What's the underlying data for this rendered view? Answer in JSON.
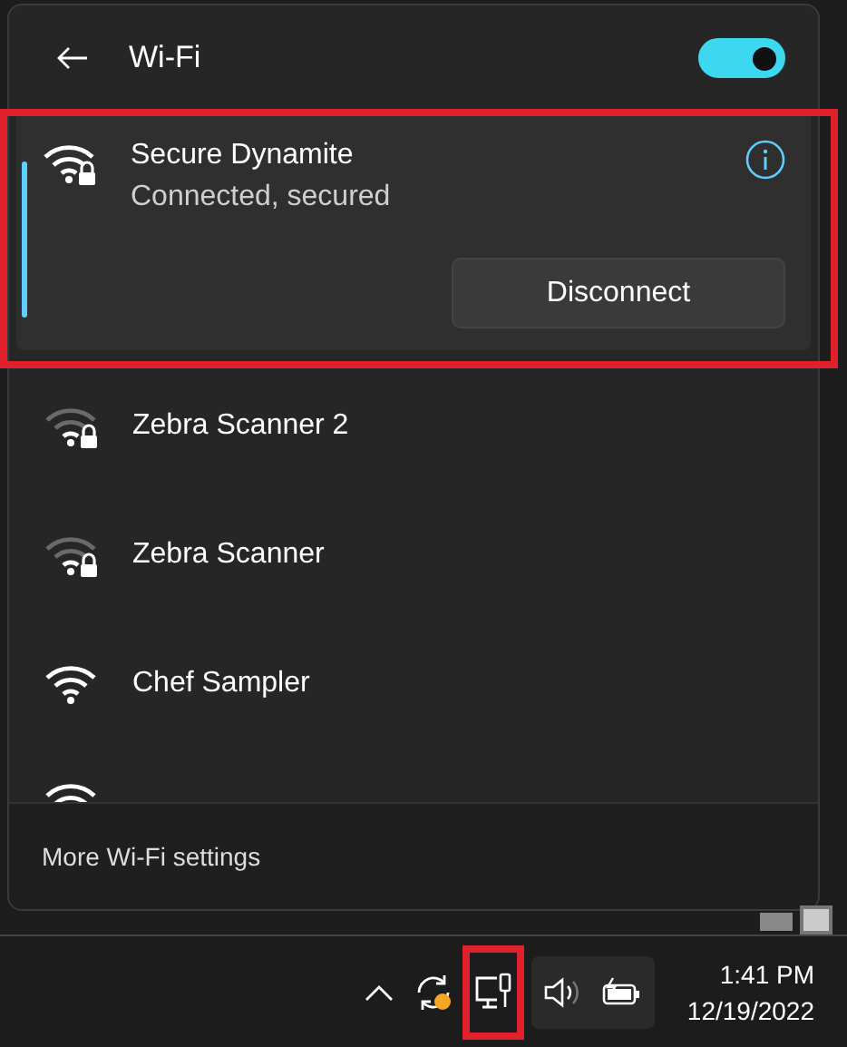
{
  "header": {
    "title": "Wi-Fi",
    "wifi_on": true
  },
  "networks": [
    {
      "name": "Secure Dynamite",
      "status": "Connected, secured",
      "kind": "strong",
      "secured": true,
      "selected": true,
      "action": "Disconnect"
    },
    {
      "name": "Zebra Scanner 2",
      "kind": "weak",
      "secured": true,
      "selected": false
    },
    {
      "name": "Zebra Scanner",
      "kind": "weak",
      "secured": true,
      "selected": false
    },
    {
      "name": "Chef Sampler",
      "kind": "strong",
      "secured": false,
      "selected": false
    },
    {
      "kind": "strong",
      "selected": false
    }
  ],
  "footer": {
    "link": "More Wi-Fi settings"
  },
  "taskbar": {
    "time": "1:41 PM",
    "date": "12/19/2022",
    "sync_alert": true
  }
}
